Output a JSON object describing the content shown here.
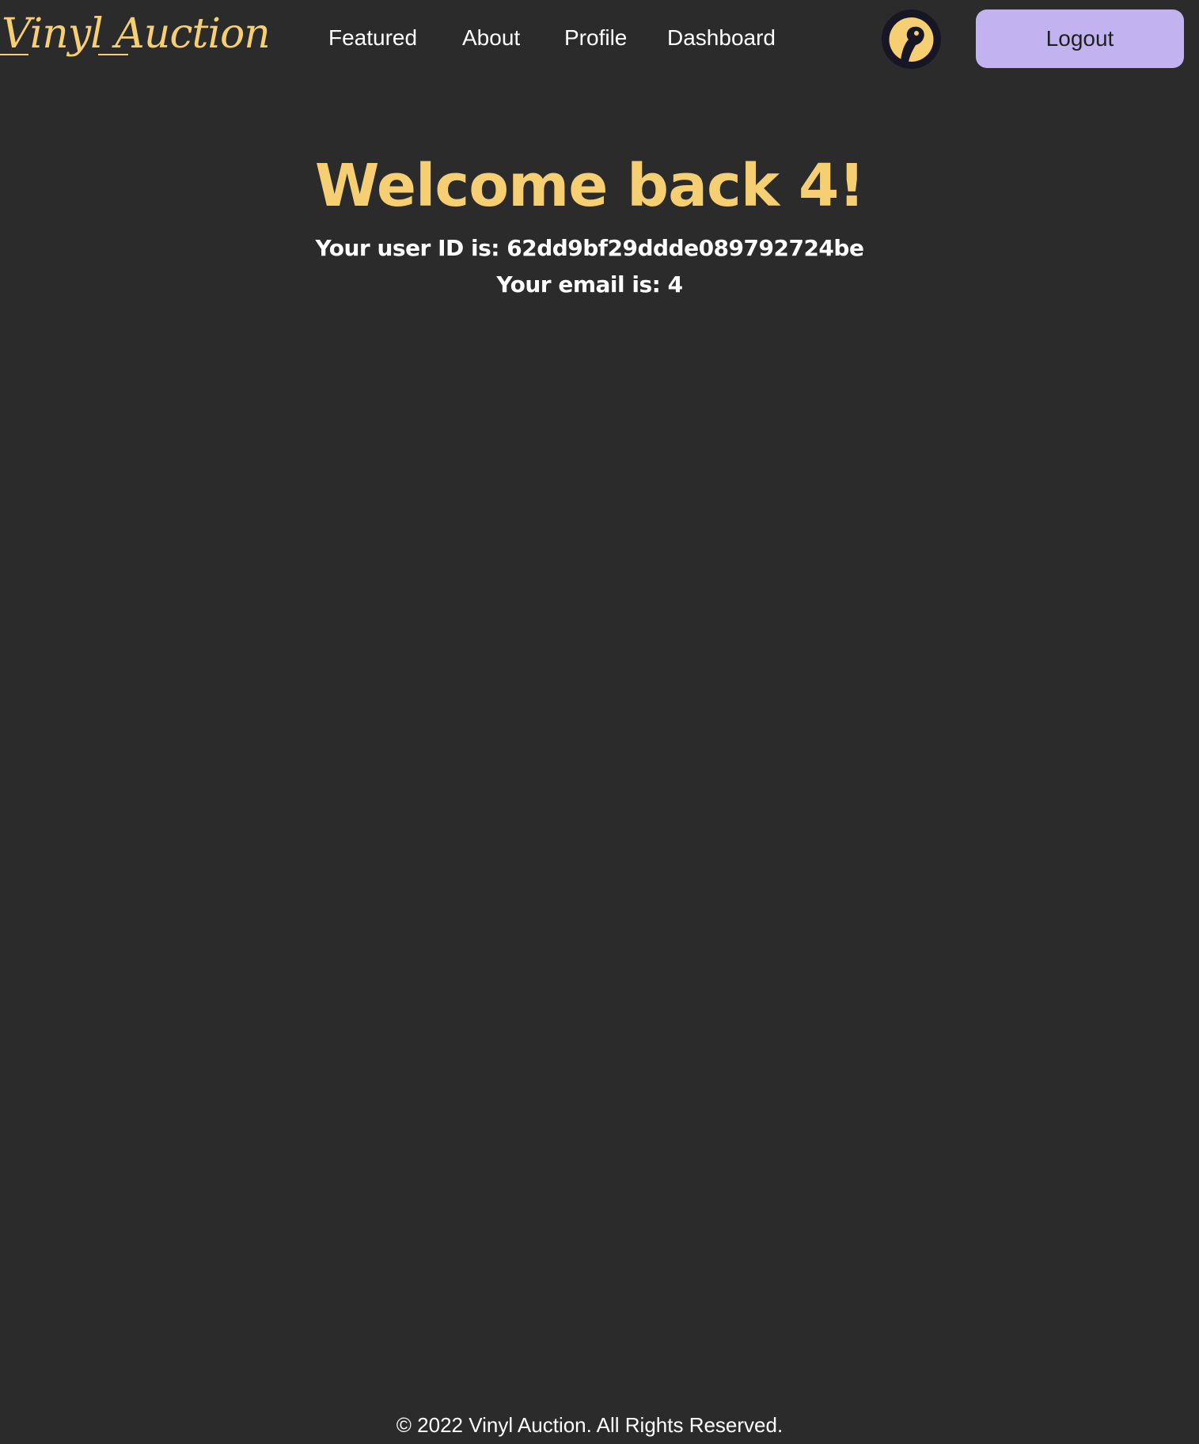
{
  "brand": {
    "name": "Vinyl Auction",
    "accent_color": "#f6cf72",
    "background_color": "#2b2b2b"
  },
  "nav": {
    "links": [
      {
        "label": "Featured"
      },
      {
        "label": "About"
      },
      {
        "label": "Profile"
      },
      {
        "label": "Dashboard"
      }
    ],
    "avatar_icon": "user-avatar-icon",
    "logout_label": "Logout",
    "logout_color": "#c2b3f0"
  },
  "main": {
    "welcome_title": "Welcome back 4!",
    "user_id_line": "Your user ID is: 62dd9bf29ddde089792724be",
    "email_line": "Your email is: 4"
  },
  "footer": {
    "copyright": "© 2022 Vinyl Auction. All Rights Reserved."
  }
}
